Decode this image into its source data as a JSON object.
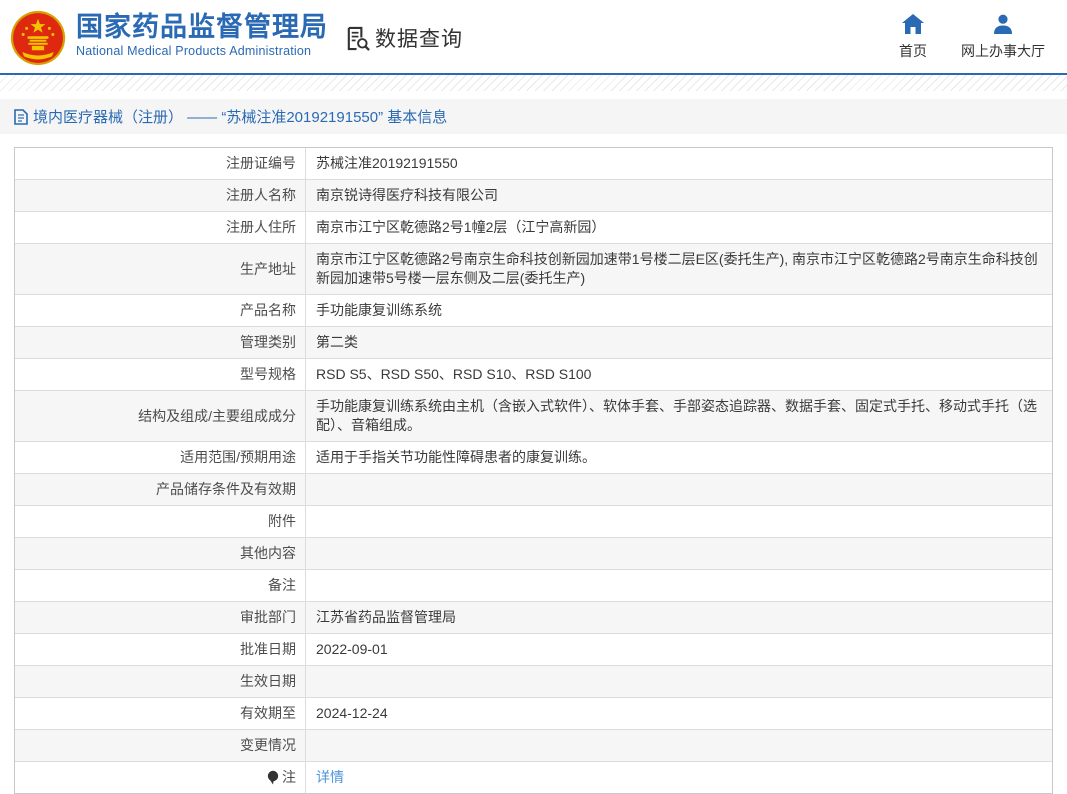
{
  "header": {
    "title": "国家药品监督管理局",
    "subtitle": "National Medical Products Administration",
    "section_label": "数据查询",
    "nav": [
      {
        "label": "首页",
        "icon": "home-icon"
      },
      {
        "label": "网上办事大厅",
        "icon": "user-icon"
      }
    ]
  },
  "breadcrumb": {
    "text": "境内医疗器械（注册） —— “苏械注准20192191550” 基本信息"
  },
  "table": {
    "rows": [
      {
        "label": "注册证编号",
        "value": "苏械注准20192191550"
      },
      {
        "label": "注册人名称",
        "value": "南京锐诗得医疗科技有限公司"
      },
      {
        "label": "注册人住所",
        "value": "南京市江宁区乾德路2号1幢2层（江宁高新园）"
      },
      {
        "label": "生产地址",
        "value": "南京市江宁区乾德路2号南京生命科技创新园加速带1号楼二层E区(委托生产), 南京市江宁区乾德路2号南京生命科技创新园加速带5号楼一层东侧及二层(委托生产)"
      },
      {
        "label": "产品名称",
        "value": "手功能康复训练系统"
      },
      {
        "label": "管理类别",
        "value": "第二类"
      },
      {
        "label": "型号规格",
        "value": "RSD S5、RSD S50、RSD S10、RSD S100"
      },
      {
        "label": "结构及组成/主要组成成分",
        "value": "手功能康复训练系统由主机（含嵌入式软件）、软体手套、手部姿态追踪器、数据手套、固定式手托、移动式手托（选配）、音箱组成。"
      },
      {
        "label": "适用范围/预期用途",
        "value": "适用于手指关节功能性障碍患者的康复训练。"
      },
      {
        "label": "产品储存条件及有效期",
        "value": ""
      },
      {
        "label": "附件",
        "value": ""
      },
      {
        "label": "其他内容",
        "value": ""
      },
      {
        "label": "备注",
        "value": ""
      },
      {
        "label": "审批部门",
        "value": "江苏省药品监督管理局"
      },
      {
        "label": "批准日期",
        "value": "2022-09-01"
      },
      {
        "label": "生效日期",
        "value": ""
      },
      {
        "label": "有效期至",
        "value": "2024-12-24"
      },
      {
        "label": "变更情况",
        "value": ""
      },
      {
        "label": "注",
        "value": "详情"
      }
    ]
  },
  "colors": {
    "brand_blue": "#2a6ab4",
    "link_blue": "#4e93de",
    "row_alt_bg": "#f6f6f6",
    "emblem_red": "#de2910",
    "emblem_gold": "#f2c500"
  }
}
